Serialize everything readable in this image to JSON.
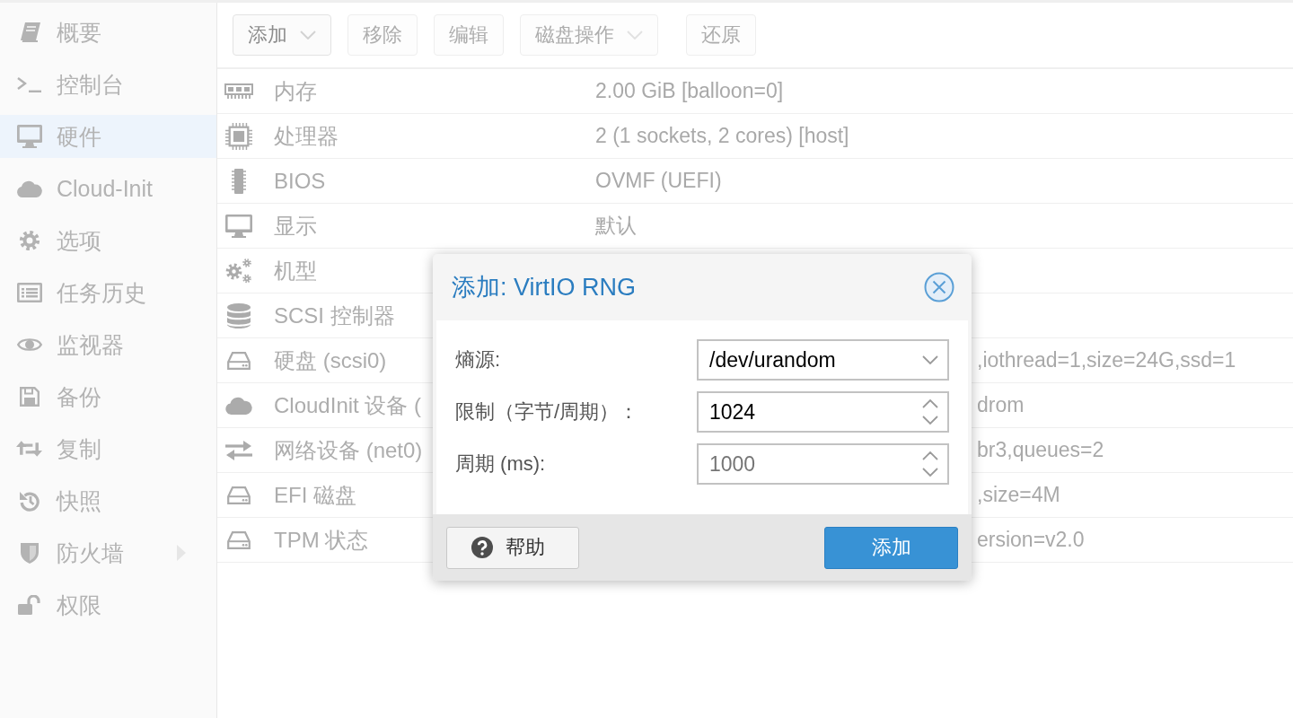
{
  "sidebar": {
    "items": [
      {
        "label": "概要",
        "selected": false,
        "expandable": false
      },
      {
        "label": "控制台",
        "selected": false,
        "expandable": false
      },
      {
        "label": "硬件",
        "selected": true,
        "expandable": false
      },
      {
        "label": "Cloud-Init",
        "selected": false,
        "expandable": false
      },
      {
        "label": "选项",
        "selected": false,
        "expandable": false
      },
      {
        "label": "任务历史",
        "selected": false,
        "expandable": false
      },
      {
        "label": "监视器",
        "selected": false,
        "expandable": false
      },
      {
        "label": "备份",
        "selected": false,
        "expandable": false
      },
      {
        "label": "复制",
        "selected": false,
        "expandable": false
      },
      {
        "label": "快照",
        "selected": false,
        "expandable": false
      },
      {
        "label": "防火墙",
        "selected": false,
        "expandable": true
      },
      {
        "label": "权限",
        "selected": false,
        "expandable": false
      }
    ]
  },
  "toolbar": {
    "buttons": [
      {
        "label": "添加",
        "dropdown": true,
        "disabled": false
      },
      {
        "label": "移除",
        "dropdown": false,
        "disabled": true
      },
      {
        "label": "编辑",
        "dropdown": false,
        "disabled": true
      },
      {
        "label": "磁盘操作",
        "dropdown": true,
        "disabled": true
      },
      {
        "label": "还原",
        "dropdown": false,
        "disabled": true
      }
    ]
  },
  "table": {
    "rows": [
      {
        "label": "内存",
        "value": "2.00 GiB [balloon=0]",
        "selected": false
      },
      {
        "label": "处理器",
        "value": "2 (1 sockets, 2 cores) [host]",
        "selected": false
      },
      {
        "label": "BIOS",
        "value": "OVMF (UEFI)",
        "selected": false
      },
      {
        "label": "显示",
        "value": "默认",
        "selected": false
      },
      {
        "label": "机型",
        "selected": false
      },
      {
        "label": "SCSI 控制器",
        "selected": false
      },
      {
        "label": "硬盘 (scsi0)",
        "value": ",iothread=1,size=24G,ssd=1",
        "selected": false
      },
      {
        "label": "CloudInit 设备 (",
        "value": "drom",
        "selected": false
      },
      {
        "label": "网络设备 (net0)",
        "value": "br3,queues=2",
        "selected": false
      },
      {
        "label": "EFI 磁盘",
        "value": ",size=4M",
        "selected": false
      },
      {
        "label": "TPM 状态",
        "value": "ersion=v2.0",
        "selected": false
      }
    ]
  },
  "dialog": {
    "title": "添加: VirtIO RNG",
    "fields": [
      {
        "label": "熵源:",
        "kind": "select",
        "value": "/dev/urandom"
      },
      {
        "label": "限制（字节/周期）：",
        "kind": "number",
        "value": "1024"
      },
      {
        "label": "周期 (ms):",
        "kind": "number",
        "placeholder": "1000"
      }
    ],
    "buttons": [
      {
        "label": "帮助",
        "kind": "help"
      },
      {
        "label": "添加",
        "kind": "primary"
      }
    ]
  }
}
